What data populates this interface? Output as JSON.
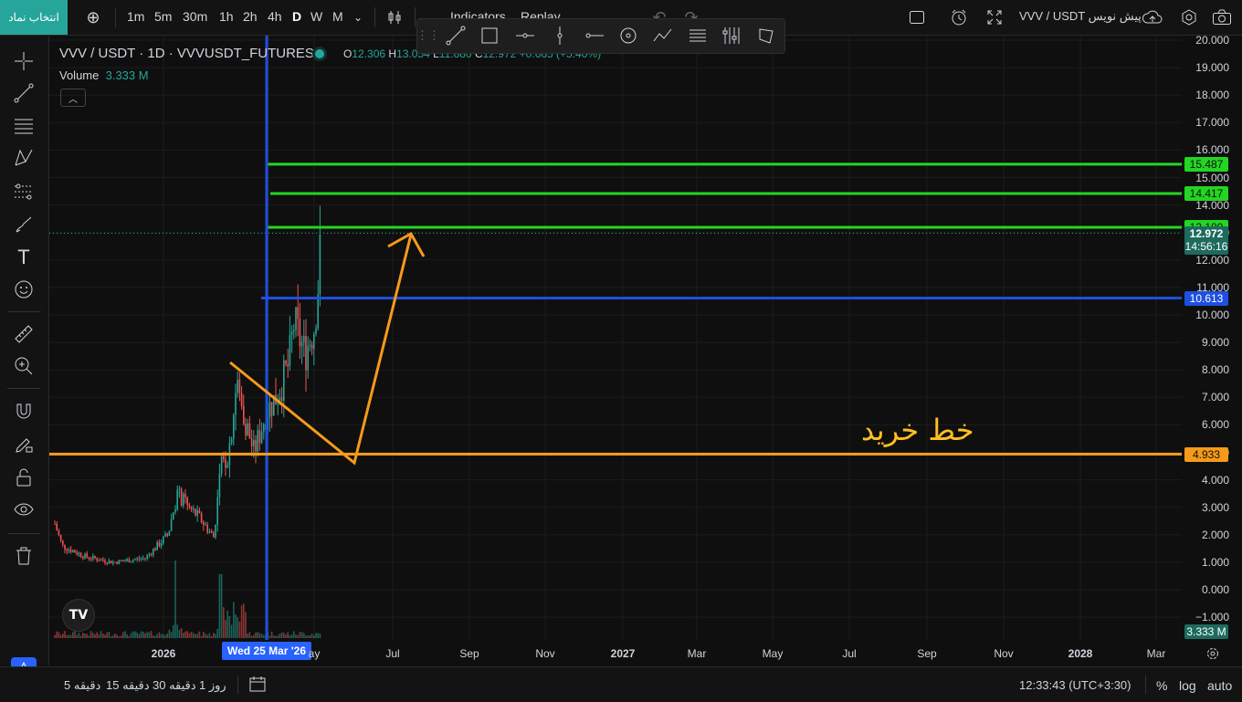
{
  "app": {
    "symbol_button": "انتخاب نماد",
    "layout_name": "VVV / USDT پیش نویس",
    "timeframes": [
      "1m",
      "5m",
      "30m",
      "1h",
      "2h",
      "4h",
      "D",
      "W",
      "M"
    ],
    "active_timeframe": "D",
    "indicators_label": "Indicators",
    "replay_label": "Replay"
  },
  "legend": {
    "title": "VVV / USDT · 1D · VVVUSDT_FUTURES",
    "open_label": "O",
    "open": "12.306",
    "high_label": "H",
    "high": "13.054",
    "low_label": "L",
    "low": "11.880",
    "close_label": "C",
    "close": "12.972",
    "change": "+0.665 (+5.40%)",
    "volume_label": "Volume",
    "volume_value": "3.333 M"
  },
  "price_axis": {
    "labels": [
      "20.000",
      "19.000",
      "18.000",
      "17.000",
      "16.000",
      "15.000",
      "14.000",
      "13.000",
      "12.000",
      "11.000",
      "10.000",
      "9.000",
      "8.000",
      "7.000",
      "6.000",
      "5.000",
      "4.000",
      "3.000",
      "2.000",
      "1.000",
      "0.000",
      "−1.000"
    ],
    "tags": [
      {
        "value": "15.487",
        "color": "#22d622"
      },
      {
        "value": "14.417",
        "color": "#22d622"
      },
      {
        "value": "13.189",
        "color": "#22d622"
      },
      {
        "value": "10.613",
        "color": "#1e4fe0"
      },
      {
        "value": "4.933",
        "color": "#f59a1a"
      }
    ],
    "last_price": "12.972",
    "countdown": "14:56:16",
    "volume_tag": "3.333 M"
  },
  "time_axis": {
    "labels": [
      "2026",
      "Wed 25 Mar '26",
      "ay",
      "Jul",
      "Sep",
      "Nov",
      "2027",
      "Mar",
      "May",
      "Jul",
      "Sep",
      "Nov",
      "2028",
      "Mar"
    ],
    "highlight": "Wed 25 Mar '26"
  },
  "chart": {
    "annotation_text": "خط خرید",
    "colors": {
      "up": "#26a69a",
      "down": "#ef5350",
      "green_line": "#22d622",
      "blue_line": "#1e4fe0",
      "orange": "#f59a1a"
    }
  },
  "bottom": {
    "ranges": [
      "5 دقیقه",
      "15 دقیقه",
      "30 دقیقه",
      "1 روز"
    ],
    "time": "12:33:43 (UTC+3:30)",
    "percent": "%",
    "log": "log",
    "auto": "auto"
  }
}
